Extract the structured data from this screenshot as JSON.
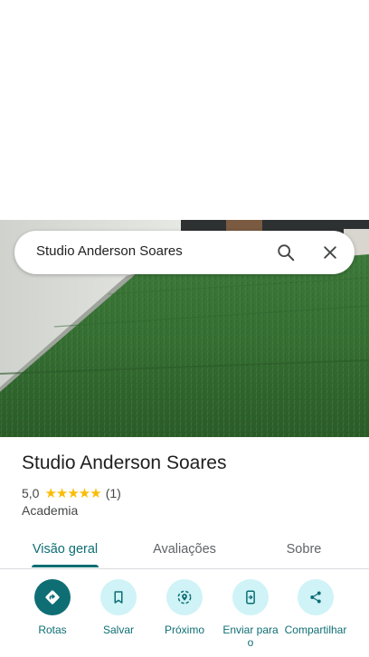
{
  "search": {
    "query": "Studio Anderson Soares",
    "search_icon": "search-icon",
    "close_icon": "close-icon"
  },
  "place": {
    "name": "Studio Anderson Soares",
    "rating": "5,0",
    "stars": "★★★★★",
    "review_count": "(1)",
    "category": "Academia"
  },
  "tabs": [
    {
      "label": "Visão geral",
      "active": true
    },
    {
      "label": "Avaliações",
      "active": false
    },
    {
      "label": "Sobre",
      "active": false
    }
  ],
  "actions": [
    {
      "label": "Rotas",
      "icon": "directions-icon"
    },
    {
      "label": "Salvar",
      "icon": "bookmark-icon"
    },
    {
      "label": "Próximo",
      "icon": "nearby-icon"
    },
    {
      "label": "Enviar para o",
      "icon": "send-to-phone-icon"
    },
    {
      "label": "Compartilhar",
      "icon": "share-icon"
    }
  ],
  "colors": {
    "accent": "#0e6e74",
    "action_bg": "#cff3f7",
    "star": "#fbbc04"
  }
}
